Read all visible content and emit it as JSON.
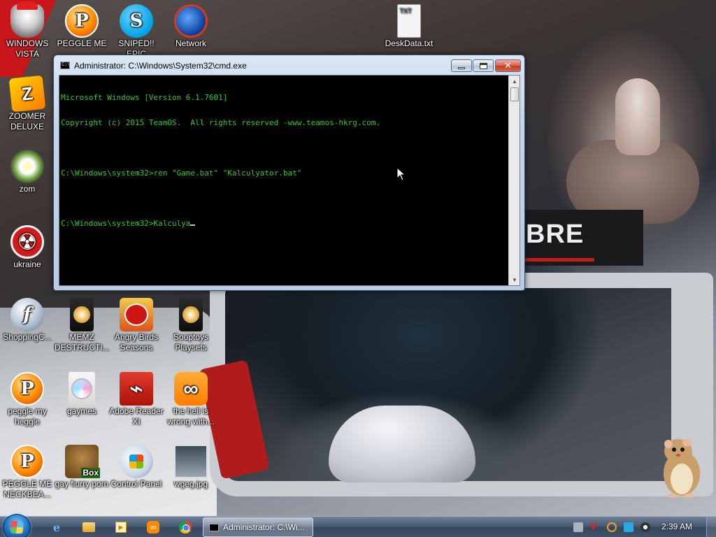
{
  "desktop": {
    "icons": [
      {
        "label": "WINDOWS VISTA",
        "icon": "windows-vista-icon"
      },
      {
        "label": "PEGGLE ME",
        "icon": "peggle-icon"
      },
      {
        "label": "SNIPED!! EPIC",
        "icon": "skype-icon"
      },
      {
        "label": "Network",
        "icon": "network-icon"
      },
      {
        "label": "DeskData.txt",
        "icon": "text-file-icon"
      },
      {
        "label": "ZOOMER DELUXE",
        "icon": "zoomer-icon"
      },
      {
        "label": "zom",
        "icon": "plants-vs-zombies-icon"
      },
      {
        "label": "ukraine",
        "icon": "radiation-icon"
      },
      {
        "label": "ShoppingC...",
        "icon": "flash-icon"
      },
      {
        "label": "MEMZ DESTRUCTI...",
        "icon": "memz-icon"
      },
      {
        "label": "Angry Birds Seasons",
        "icon": "angry-birds-icon"
      },
      {
        "label": "Souptoys Playsets",
        "icon": "souptoys-icon"
      },
      {
        "label": "peggle my heggle",
        "icon": "peggle-icon"
      },
      {
        "label": "gaymes",
        "icon": "disc-icon"
      },
      {
        "label": "Adobe Reader XI",
        "icon": "pdf-icon"
      },
      {
        "label": "the hell is wrong with...",
        "icon": "uc-browser-icon"
      },
      {
        "label": "PEGGLE ME NECKBEA...",
        "icon": "peggle-icon"
      },
      {
        "label": "gay fiurry porn",
        "icon": "bear-box-icon"
      },
      {
        "label": "Control Panel",
        "icon": "control-panel-icon"
      },
      {
        "label": "wgeg.jpg",
        "icon": "image-file-icon"
      }
    ],
    "wallpaper_text": "BRE"
  },
  "cmd_window": {
    "title": "Administrator: C:\\Windows\\System32\\cmd.exe",
    "lines": [
      "Microsoft Windows [Version 6.1.7601]",
      "Copyright (c) 2015 TeamOS.  All rights reserved -www.teamos-hkrg.com.",
      "",
      "C:\\Windows\\system32>ren \"Game.bat\" \"Kalculyator.bat\"",
      "",
      "C:\\Windows\\system32>Kalculya"
    ],
    "background": "#000000",
    "text_color": "#2ec92e"
  },
  "taskbar": {
    "pinned": [
      "internet-explorer-icon",
      "windows-explorer-icon",
      "media-player-icon",
      "uc-browser-icon",
      "chrome-icon"
    ],
    "active_task": "Administrator: C:\\Wi...",
    "clock": "2:39 AM",
    "tray": [
      "network-tray-icon",
      "antivirus-tray-icon",
      "search-tray-icon",
      "display-tray-icon",
      "volume-tray-icon"
    ]
  }
}
